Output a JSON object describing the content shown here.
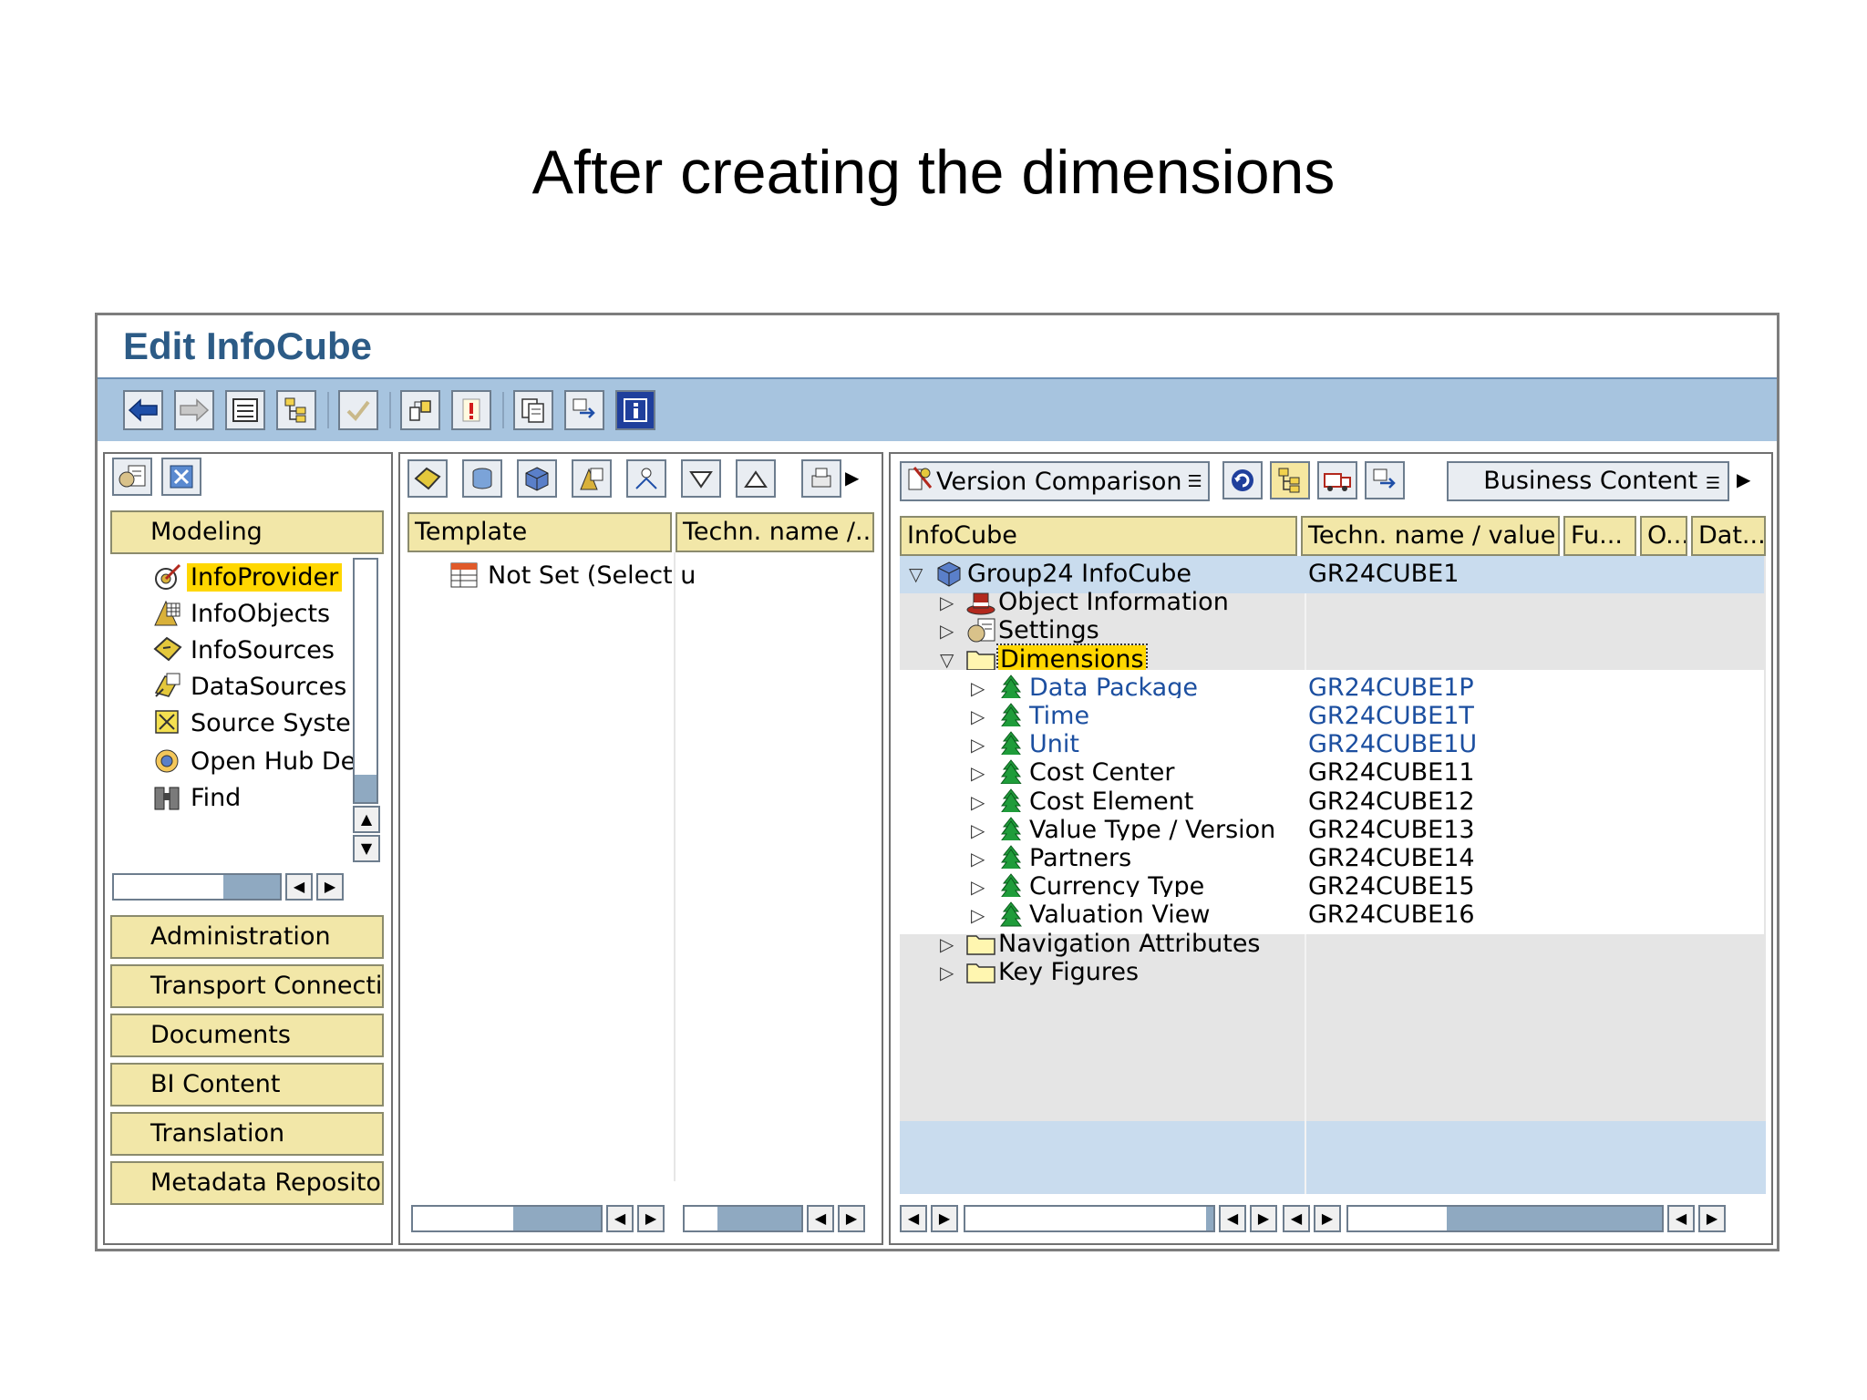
{
  "slide": {
    "title": "After creating the dimensions"
  },
  "window": {
    "title": "Edit InfoCube"
  },
  "navigator": {
    "sections": [
      "Modeling",
      "Administration",
      "Transport Connectio",
      "Documents",
      "BI Content",
      "Translation",
      "Metadata Repository"
    ],
    "tree": [
      "InfoProvider",
      "InfoObjects",
      "InfoSources",
      "DataSources",
      "Source Syste",
      "Open Hub De",
      "Find"
    ]
  },
  "template_panel": {
    "columns": [
      "Template",
      "Techn. name /..."
    ],
    "rows": [
      "Not Set (Select u"
    ]
  },
  "editor": {
    "toolbar": {
      "version_comparison": "Version Comparison",
      "business_content": "Business Content"
    },
    "columns": [
      "InfoCube",
      "Techn. name / value",
      "Fu...",
      "O...",
      "Dat..."
    ],
    "tree": [
      {
        "label": "Group24 InfoCube",
        "tech": "GR24CUBE1",
        "level": 0,
        "icon": "cube-icon",
        "expanded": true
      },
      {
        "label": "Object Information",
        "tech": "",
        "level": 1,
        "icon": "hat-icon",
        "expanded": false
      },
      {
        "label": "Settings",
        "tech": "",
        "level": 1,
        "icon": "settings-icon",
        "expanded": false
      },
      {
        "label": "Dimensions",
        "tech": "",
        "level": 1,
        "icon": "folder-icon",
        "expanded": true,
        "selected": true
      },
      {
        "label": "Data Package",
        "tech": "GR24CUBE1P",
        "level": 2,
        "icon": "dimension-icon",
        "expanded": false,
        "system": true
      },
      {
        "label": "Time",
        "tech": "GR24CUBE1T",
        "level": 2,
        "icon": "dimension-icon",
        "expanded": false,
        "system": true
      },
      {
        "label": "Unit",
        "tech": "GR24CUBE1U",
        "level": 2,
        "icon": "dimension-icon",
        "expanded": false,
        "system": true
      },
      {
        "label": "Cost Center",
        "tech": "GR24CUBE11",
        "level": 2,
        "icon": "dimension-icon",
        "expanded": false
      },
      {
        "label": "Cost Element",
        "tech": "GR24CUBE12",
        "level": 2,
        "icon": "dimension-icon",
        "expanded": false
      },
      {
        "label": "Value Type / Version",
        "tech": "GR24CUBE13",
        "level": 2,
        "icon": "dimension-icon",
        "expanded": false
      },
      {
        "label": "Partners",
        "tech": "GR24CUBE14",
        "level": 2,
        "icon": "dimension-icon",
        "expanded": false
      },
      {
        "label": "Currency Type",
        "tech": "GR24CUBE15",
        "level": 2,
        "icon": "dimension-icon",
        "expanded": false
      },
      {
        "label": "Valuation View",
        "tech": "GR24CUBE16",
        "level": 2,
        "icon": "dimension-icon",
        "expanded": false
      },
      {
        "label": "Navigation Attributes",
        "tech": "",
        "level": 1,
        "icon": "folder-icon",
        "expanded": false
      },
      {
        "label": "Key Figures",
        "tech": "",
        "level": 1,
        "icon": "folder-icon",
        "expanded": false
      }
    ]
  },
  "colors": {
    "toolbar_bg": "#a7c4df",
    "header_bg": "#f2e7a8",
    "title_blue": "#2c5b86",
    "selected_bg": "#ffd700",
    "link_blue": "#1c4fa0"
  }
}
